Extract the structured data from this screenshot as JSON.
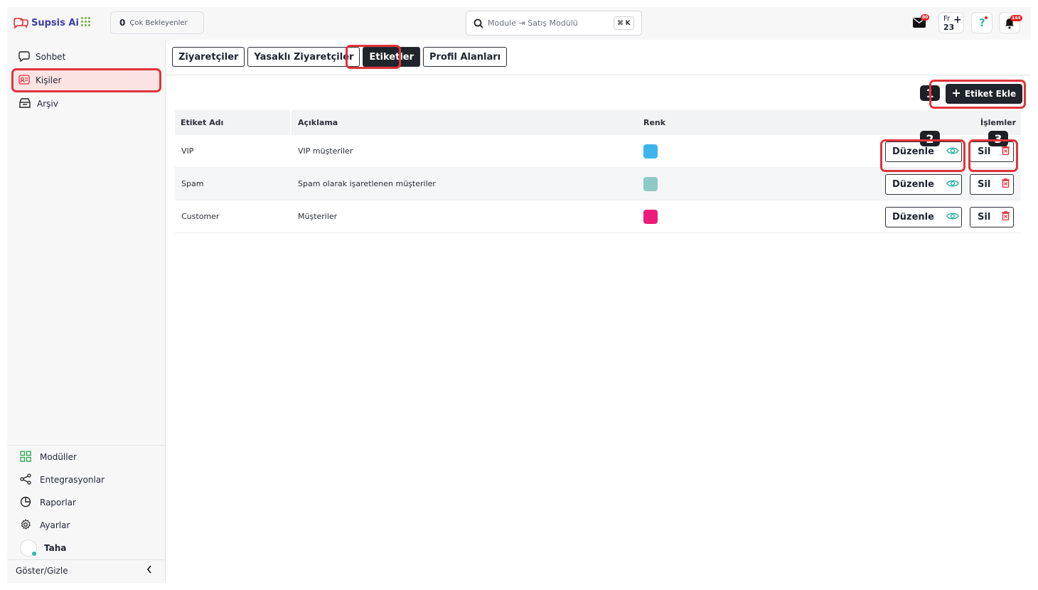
{
  "brand": {
    "name": "Supsis Ai"
  },
  "header": {
    "pending_count": "0",
    "pending_label": "Çok Bekleyenler",
    "search_placeholder": "Module ⇥ Satış Modülü",
    "search_shortcut": "⌘ K",
    "mail_badge": "80",
    "lang_code": "Fr",
    "lang_number": "23",
    "bell_badge": "144"
  },
  "sidebar": {
    "items": [
      {
        "label": "Sohbet",
        "icon": "chat-icon"
      },
      {
        "label": "Kişiler",
        "icon": "contact-card-icon",
        "active": true
      },
      {
        "label": "Arşiv",
        "icon": "archive-icon"
      }
    ],
    "bottom_items": [
      {
        "label": "Modüller",
        "icon": "modules-grid-icon"
      },
      {
        "label": "Entegrasyonlar",
        "icon": "share-nodes-icon"
      },
      {
        "label": "Raporlar",
        "icon": "pie-chart-icon"
      },
      {
        "label": "Ayarlar",
        "icon": "gear-icon"
      }
    ],
    "user_name": "Taha",
    "toggle_label": "Göster/Gizle"
  },
  "tabs": [
    {
      "label": "Ziyaretçiler"
    },
    {
      "label": "Yasaklı Ziyaretçiler"
    },
    {
      "label": "Etiketler",
      "active": true
    },
    {
      "label": "Profil Alanları"
    }
  ],
  "add_button_label": "Etiket Ekle",
  "annotations": {
    "one": "1",
    "two": "2",
    "three": "3"
  },
  "table": {
    "headers": {
      "name": "Etiket Adı",
      "description": "Açıklama",
      "color": "Renk",
      "actions": "İşlemler"
    },
    "rows": [
      {
        "name": "VIP",
        "description": "VIP müşteriler",
        "color": "#3db5ea",
        "edit": "Düzenle",
        "delete": "Sil"
      },
      {
        "name": "Spam",
        "description": "Spam olarak işaretlenen müşteriler",
        "color": "#8ec9c6",
        "edit": "Düzenle",
        "delete": "Sil"
      },
      {
        "name": "Customer",
        "description": "Müşteriler",
        "color": "#ee1b7b",
        "edit": "Düzenle",
        "delete": "Sil"
      }
    ]
  },
  "colors": {
    "accent_dark": "#20242b",
    "highlight_red": "#e0333a",
    "eye_teal": "#2fb7a8",
    "trash_red": "#e0333a"
  }
}
